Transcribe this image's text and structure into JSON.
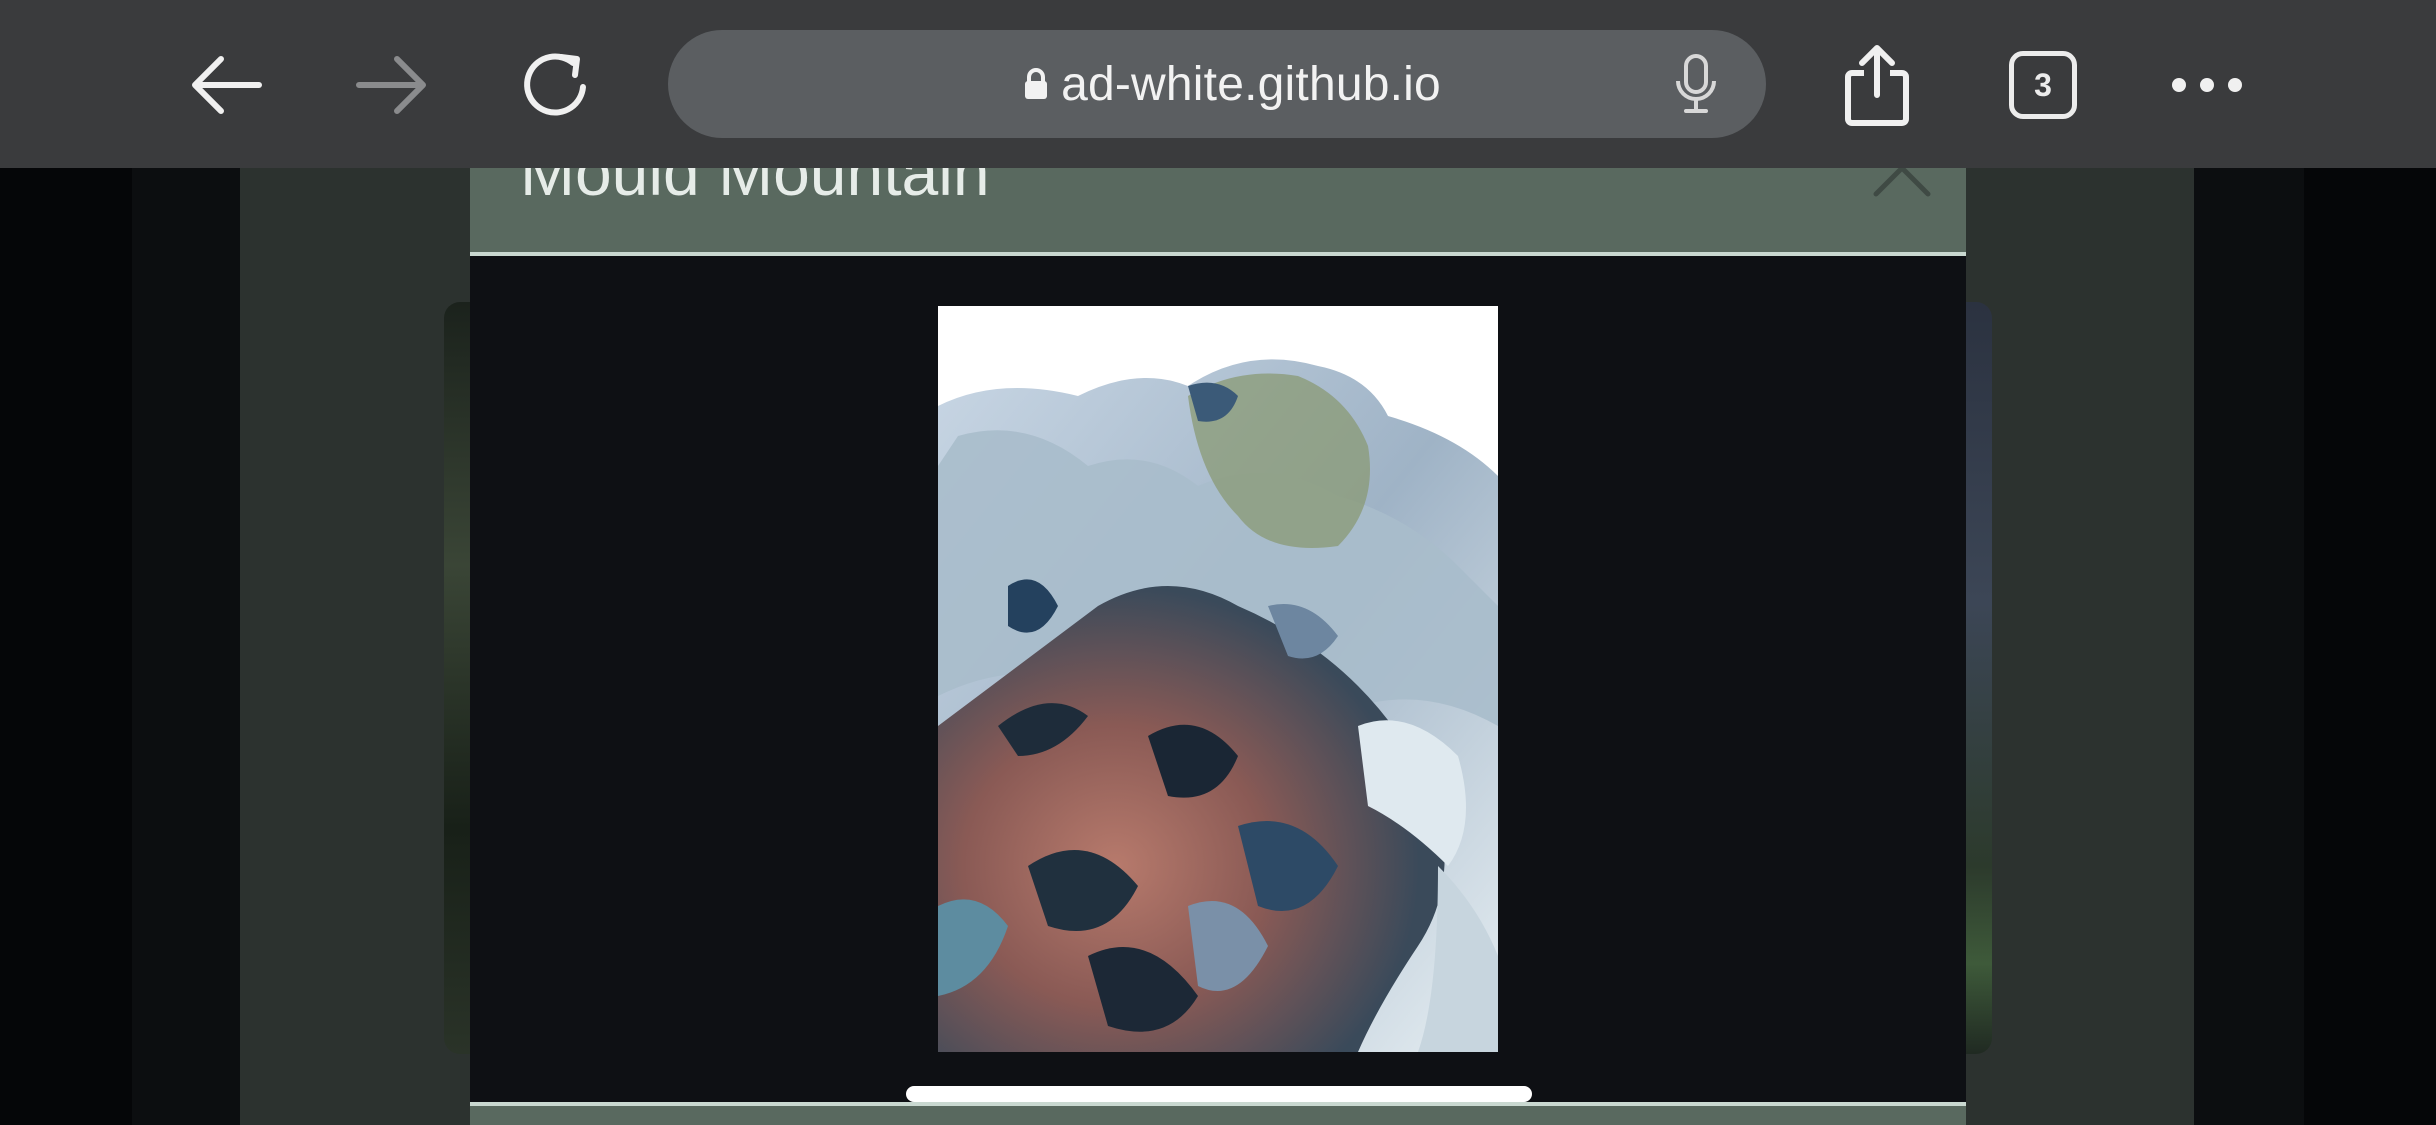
{
  "browser": {
    "url": "ad-white.github.io",
    "tab_count": "3",
    "icons": {
      "back": "arrow-left-icon",
      "forward": "arrow-right-icon",
      "reload": "reload-icon",
      "lock": "lock-icon",
      "mic": "microphone-icon",
      "share": "share-icon",
      "tabs": "tabs-icon",
      "more": "more-dots-icon"
    },
    "forward_enabled": false
  },
  "modal": {
    "title": "Mould Mountain",
    "close_icon": "close-icon",
    "header_color": "#59695f",
    "body_color": "#0e1014"
  },
  "image": {
    "subject": "mould-mountain-artwork"
  },
  "colors": {
    "toolbar": "#3a3b3d",
    "address_bar": "#5b5e61",
    "page_panel": "#2c322f"
  }
}
